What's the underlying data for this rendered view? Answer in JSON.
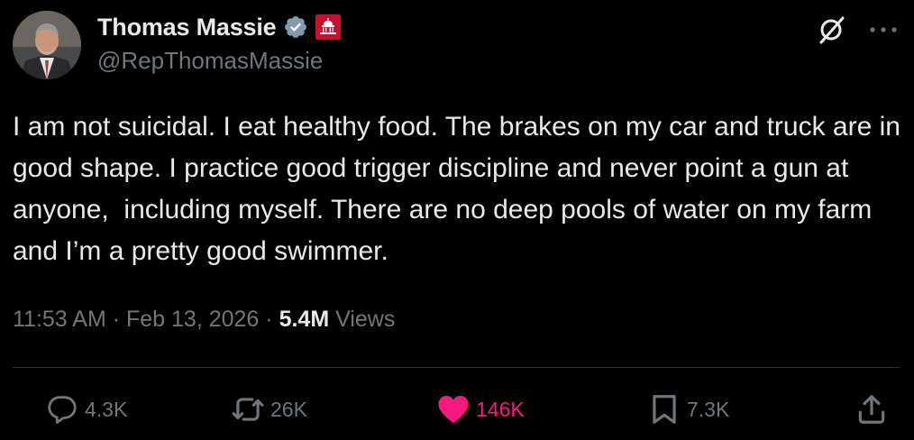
{
  "author": {
    "display_name": "Thomas Massie",
    "handle": "@RepThomasMassie",
    "verified_color": "#829aab",
    "affiliation_badge": "capitol-icon",
    "affiliation_color": "#c8102e"
  },
  "tweet": {
    "text": "I am not suicidal. I eat healthy food. The brakes on my car and truck are in good shape. I practice good trigger discipline and never point a gun at anyone,  including myself. There are no deep pools of water on my farm and I’m a pretty good swimmer.",
    "time": "11:53 AM",
    "separator": " · ",
    "date": "Feb 13, 2026",
    "views_count": "5.4M",
    "views_label": "Views"
  },
  "actions": {
    "replies": "4.3K",
    "reposts": "26K",
    "likes": "146K",
    "bookmarks": "7.3K"
  },
  "colors": {
    "background": "#000000",
    "text": "#e7e9ea",
    "muted": "#71767b",
    "like": "#f91880",
    "divider": "#2f3336"
  }
}
